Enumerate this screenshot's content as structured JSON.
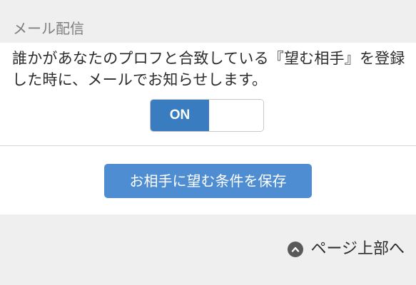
{
  "section": {
    "title": "メール配信"
  },
  "notification": {
    "description": "誰かがあなたのプロフと合致している『望む相手』を登録した時に、メールでお知らせします。",
    "toggle": {
      "on_label": "ON",
      "state": "on",
      "on_color": "#3a7cc0"
    }
  },
  "save": {
    "label": "お相手に望む条件を保存",
    "color": "#4f8dd2"
  },
  "footer": {
    "page_top_label": "ページ上部へ",
    "icon": "chevron-up-icon"
  }
}
